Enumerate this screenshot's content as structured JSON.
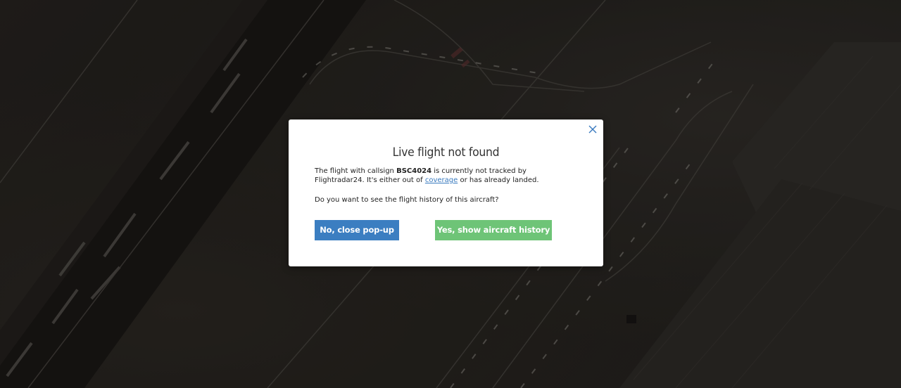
{
  "dialog": {
    "title": "Live flight not found",
    "message_prefix": "The flight with callsign ",
    "callsign": "BSC4024",
    "message_middle": " is currently not tracked by Flightradar24. It's either out of ",
    "coverage_link": "coverage",
    "message_suffix": " or has already landed.",
    "question": "Do you want to see the flight history of this aircraft?",
    "close_icon": "close-icon",
    "buttons": {
      "no_label": "No, close pop-up",
      "yes_label": "Yes, show aircraft history"
    }
  },
  "colors": {
    "primary_button": "#3b7ec1",
    "success_button": "#6ec477",
    "link": "#3a7bbf",
    "close_icon": "#3a7bbf"
  }
}
